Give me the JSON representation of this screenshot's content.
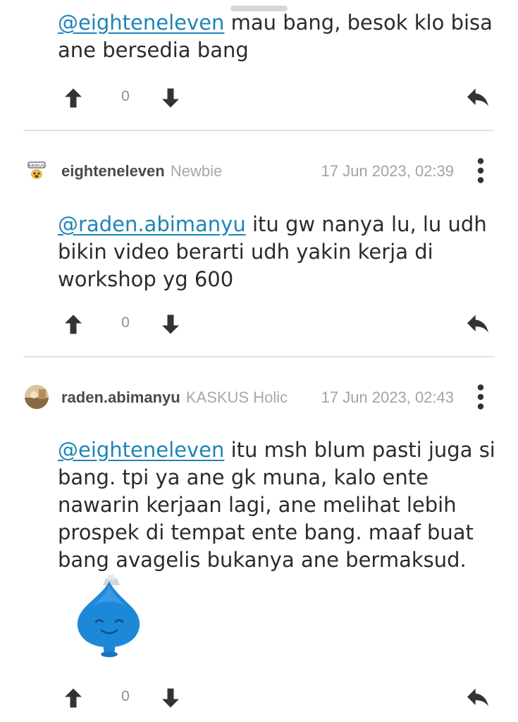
{
  "posts": [
    {
      "mention": "@eighteneleven",
      "text_line1_rest": " mau bang, besok klo bisa",
      "text_line2": "ane bersedia bang",
      "votes": "0"
    },
    {
      "username": "eighteneleven",
      "rank": "Newbie",
      "timestamp": "17 Jun 2023, 02:39",
      "mention": "@raden.abimanyu",
      "text_rest": " itu gw nanya lu, lu udh bikin video berarti udh yakin kerja di workshop yg 600",
      "votes": "0"
    },
    {
      "username": "raden.abimanyu",
      "rank": "KASKUS Holic",
      "timestamp": "17 Jun 2023, 02:43",
      "mention": "@eighteneleven",
      "text_rest": " itu msh blum pasti juga si bang. tpi ya ane gk muna, kalo ente nawarin kerjaan lagi, ane melihat lebih prospek di tempat ente bang. maaf buat bang avagelis bukanya ane bermaksud.",
      "votes": "0"
    }
  ],
  "icons": {
    "upvote": "arrow-up-icon",
    "downvote": "arrow-down-icon",
    "reply": "reply-icon",
    "more": "more-vertical-icon",
    "sticker": "blue-drop-emoticon"
  },
  "colors": {
    "mention": "#1e84b7",
    "icon": "#333333",
    "muted": "#a3a3a3"
  }
}
